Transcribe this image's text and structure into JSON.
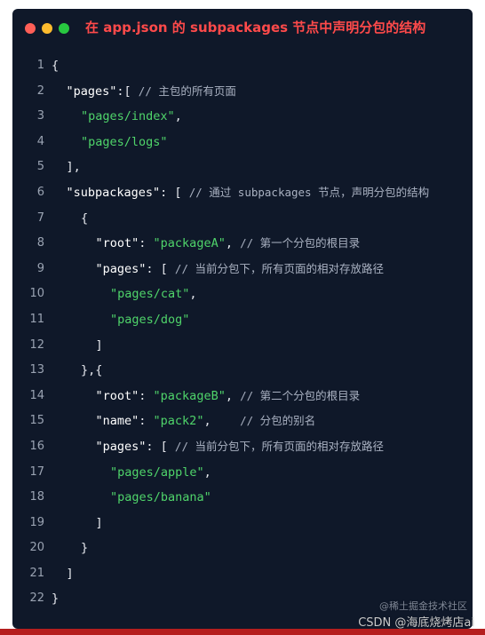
{
  "window": {
    "title": "在 app.json 的 subpackages 节点中声明分包的结构",
    "controls": {
      "close_color": "#ff5f57",
      "minimize_color": "#febc2e",
      "maximize_color": "#28c840"
    }
  },
  "code": {
    "lines": [
      {
        "num": "1",
        "indent": 0,
        "segs": [
          [
            "p",
            "{"
          ]
        ]
      },
      {
        "num": "2",
        "indent": 1,
        "segs": [
          [
            "k",
            "\"pages\""
          ],
          [
            "p",
            ":[ "
          ],
          [
            "c",
            "// 主包的所有页面"
          ]
        ]
      },
      {
        "num": "3",
        "indent": 2,
        "segs": [
          [
            "s",
            "\"pages/index\""
          ],
          [
            "p",
            ","
          ]
        ]
      },
      {
        "num": "4",
        "indent": 2,
        "segs": [
          [
            "s",
            "\"pages/logs\""
          ]
        ]
      },
      {
        "num": "5",
        "indent": 1,
        "segs": [
          [
            "p",
            "],"
          ]
        ]
      },
      {
        "num": "6",
        "indent": 1,
        "segs": [
          [
            "k",
            "\"subpackages\""
          ],
          [
            "p",
            ": [ "
          ],
          [
            "c",
            "// 通过 subpackages 节点，声明分包的结构"
          ]
        ]
      },
      {
        "num": "7",
        "indent": 2,
        "segs": [
          [
            "p",
            "{"
          ]
        ]
      },
      {
        "num": "8",
        "indent": 3,
        "segs": [
          [
            "k",
            "\"root\""
          ],
          [
            "p",
            ": "
          ],
          [
            "s",
            "\"packageA\""
          ],
          [
            "p",
            ", "
          ],
          [
            "c",
            "// 第一个分包的根目录"
          ]
        ]
      },
      {
        "num": "9",
        "indent": 3,
        "segs": [
          [
            "k",
            "\"pages\""
          ],
          [
            "p",
            ": [ "
          ],
          [
            "c",
            "// 当前分包下，所有页面的相对存放路径"
          ]
        ]
      },
      {
        "num": "10",
        "indent": 4,
        "segs": [
          [
            "s",
            "\"pages/cat\""
          ],
          [
            "p",
            ","
          ]
        ]
      },
      {
        "num": "11",
        "indent": 4,
        "segs": [
          [
            "s",
            "\"pages/dog\""
          ]
        ]
      },
      {
        "num": "12",
        "indent": 3,
        "segs": [
          [
            "p",
            "]"
          ]
        ]
      },
      {
        "num": "13",
        "indent": 2,
        "segs": [
          [
            "p",
            "},{"
          ]
        ]
      },
      {
        "num": "14",
        "indent": 3,
        "segs": [
          [
            "k",
            "\"root\""
          ],
          [
            "p",
            ": "
          ],
          [
            "s",
            "\"packageB\""
          ],
          [
            "p",
            ", "
          ],
          [
            "c",
            "// 第二个分包的根目录"
          ]
        ]
      },
      {
        "num": "15",
        "indent": 3,
        "segs": [
          [
            "k",
            "\"name\""
          ],
          [
            "p",
            ": "
          ],
          [
            "s",
            "\"pack2\""
          ],
          [
            "p",
            ",    "
          ],
          [
            "c",
            "// 分包的别名"
          ]
        ]
      },
      {
        "num": "16",
        "indent": 3,
        "segs": [
          [
            "k",
            "\"pages\""
          ],
          [
            "p",
            ": [ "
          ],
          [
            "c",
            "// 当前分包下，所有页面的相对存放路径"
          ]
        ]
      },
      {
        "num": "17",
        "indent": 4,
        "segs": [
          [
            "s",
            "\"pages/apple\""
          ],
          [
            "p",
            ","
          ]
        ]
      },
      {
        "num": "18",
        "indent": 4,
        "segs": [
          [
            "s",
            "\"pages/banana\""
          ]
        ]
      },
      {
        "num": "19",
        "indent": 3,
        "segs": [
          [
            "p",
            "]"
          ]
        ]
      },
      {
        "num": "20",
        "indent": 2,
        "segs": [
          [
            "p",
            "}"
          ]
        ]
      },
      {
        "num": "21",
        "indent": 1,
        "segs": [
          [
            "p",
            "]"
          ]
        ]
      },
      {
        "num": "22",
        "indent": 0,
        "segs": [
          [
            "p",
            "}"
          ]
        ]
      }
    ]
  },
  "watermark": {
    "main": "CSDN @海底烧烤店ai",
    "secondary": "@稀土掘金技术社区"
  }
}
